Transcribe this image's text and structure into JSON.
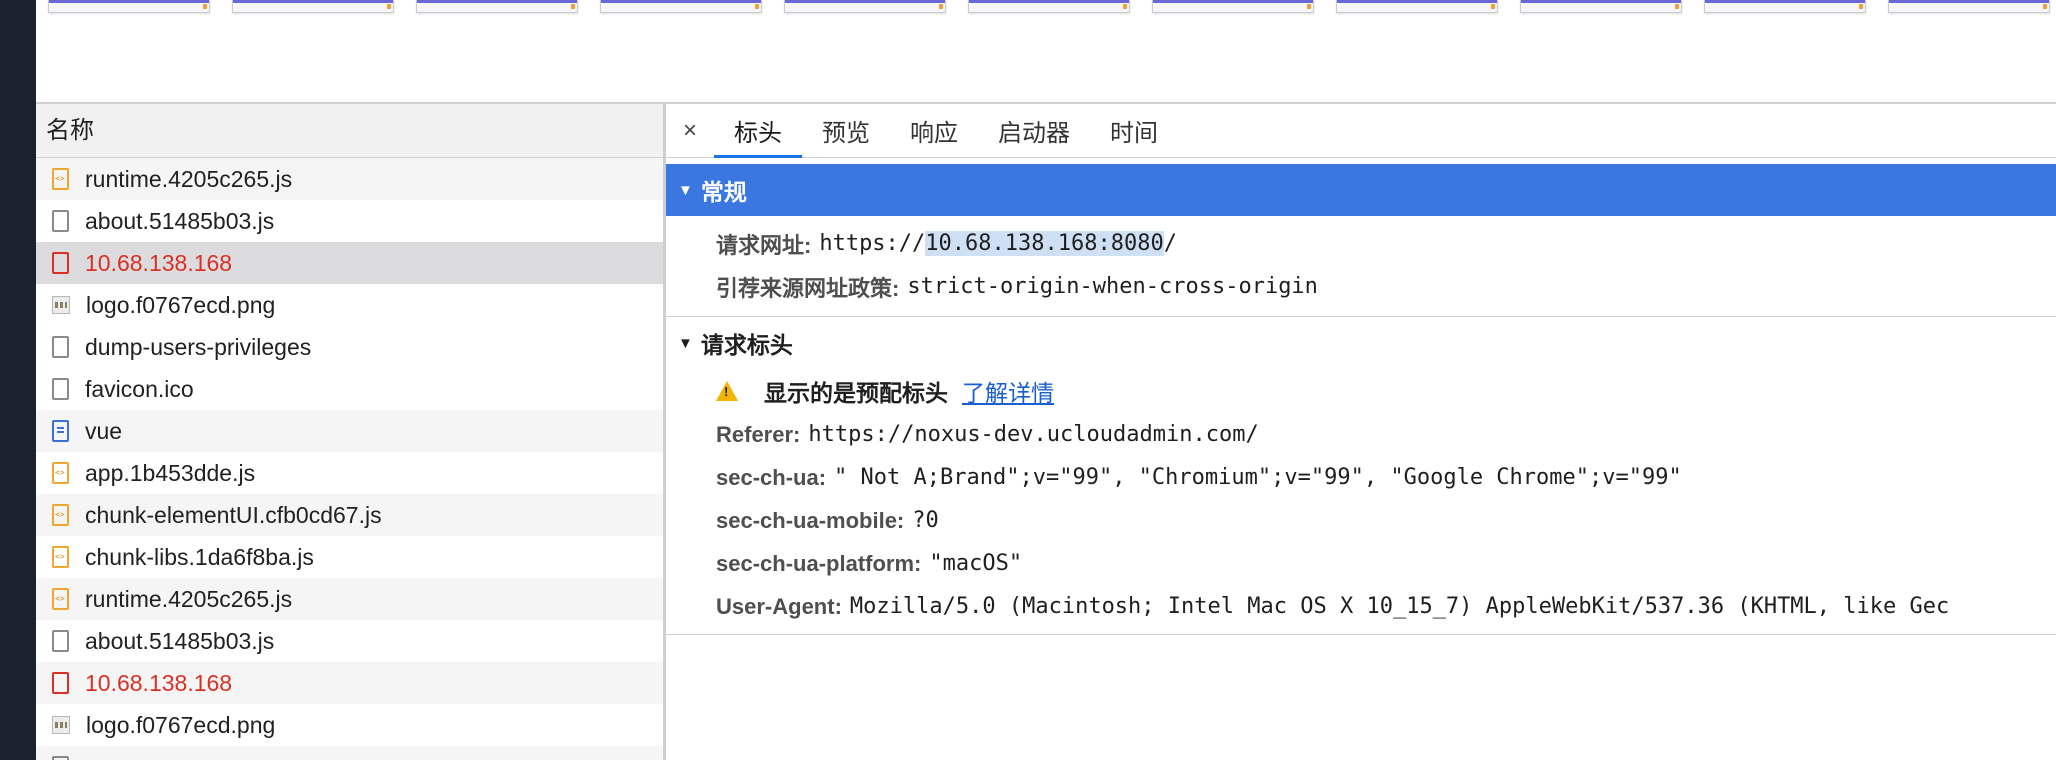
{
  "filmstrip": {
    "frame_count": 11
  },
  "left_pane": {
    "header": "名称",
    "requests": [
      {
        "name": "runtime.4205c265.js",
        "icon": "js-file-icon",
        "state": "alt"
      },
      {
        "name": "about.51485b03.js",
        "icon": "document-icon",
        "state": ""
      },
      {
        "name": "10.68.138.168",
        "icon": "error-document-icon",
        "state": "selected-error"
      },
      {
        "name": "logo.f0767ecd.png",
        "icon": "image-icon",
        "state": ""
      },
      {
        "name": "dump-users-privileges",
        "icon": "document-icon",
        "state": ""
      },
      {
        "name": "favicon.ico",
        "icon": "document-icon",
        "state": ""
      },
      {
        "name": "vue",
        "icon": "html-document-icon",
        "state": "alt"
      },
      {
        "name": "app.1b453dde.js",
        "icon": "js-file-icon",
        "state": ""
      },
      {
        "name": "chunk-elementUI.cfb0cd67.js",
        "icon": "js-file-icon",
        "state": "alt"
      },
      {
        "name": "chunk-libs.1da6f8ba.js",
        "icon": "js-file-icon",
        "state": ""
      },
      {
        "name": "runtime.4205c265.js",
        "icon": "js-file-icon",
        "state": "alt"
      },
      {
        "name": "about.51485b03.js",
        "icon": "document-icon",
        "state": ""
      },
      {
        "name": "10.68.138.168",
        "icon": "error-document-icon",
        "state": "alt-error"
      },
      {
        "name": "logo.f0767ecd.png",
        "icon": "image-icon",
        "state": ""
      },
      {
        "name": "",
        "icon": "document-icon",
        "state": "alt"
      }
    ]
  },
  "right_pane": {
    "close_label": "×",
    "tabs": [
      "标头",
      "预览",
      "响应",
      "启动器",
      "时间"
    ],
    "active_tab": "标头",
    "general": {
      "title": "常规",
      "request_url_key": "请求网址:",
      "request_url_prefix": "https://",
      "request_url_host": "10.68.138.168:8080",
      "request_url_suffix": "/",
      "referrer_policy_key": "引荐来源网址政策:",
      "referrer_policy_value": "strict-origin-when-cross-origin"
    },
    "request_headers": {
      "title": "请求标头",
      "warning_text": "显示的是预配标头",
      "warning_link": "了解详情",
      "headers": [
        {
          "key": "Referer:",
          "value": "https://noxus-dev.ucloudadmin.com/"
        },
        {
          "key": "sec-ch-ua:",
          "value": "\" Not A;Brand\";v=\"99\", \"Chromium\";v=\"99\", \"Google Chrome\";v=\"99\""
        },
        {
          "key": "sec-ch-ua-mobile:",
          "value": "?0"
        },
        {
          "key": "sec-ch-ua-platform:",
          "value": "\"macOS\""
        },
        {
          "key": "User-Agent:",
          "value": "Mozilla/5.0 (Macintosh; Intel Mac OS X 10_15_7) AppleWebKit/537.36 (KHTML, like Gec"
        }
      ]
    }
  },
  "colors": {
    "accent": "#1a73e8",
    "section_blue": "#3a77e0",
    "error_red": "#d93025",
    "link": "#1a5fd0"
  }
}
